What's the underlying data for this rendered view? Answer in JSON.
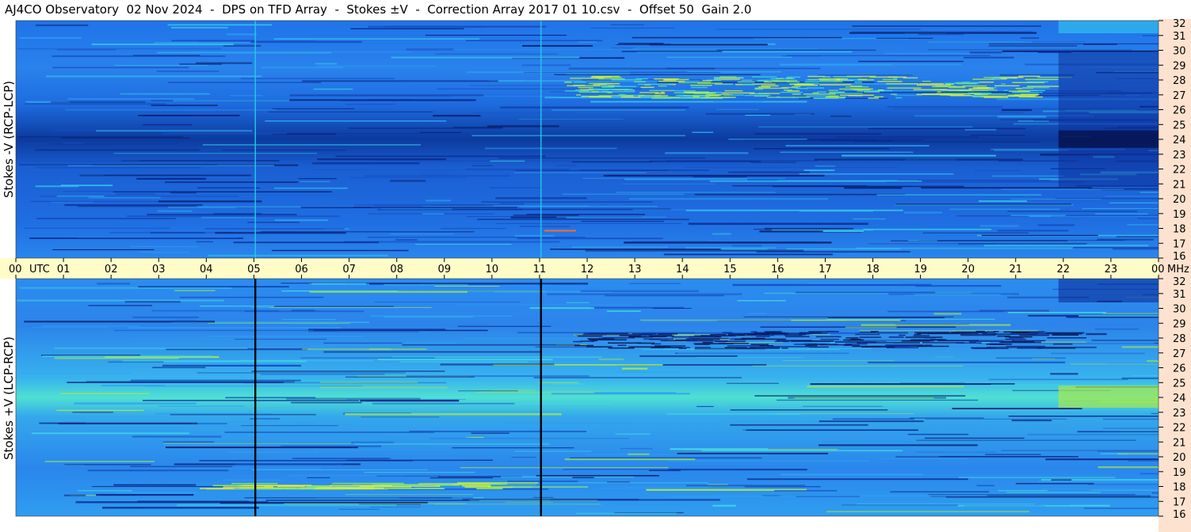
{
  "title": "AJ4CO Observatory  02 Nov 2024  -  DPS on TFD Array  -  Stokes ±V  -  Correction Array 2017 01 10.csv  -  Offset 50  Gain 2.0",
  "colors": {
    "band_bg": "#fffcc8",
    "side_bg": "#fde3cf",
    "background_blue": "#1f6fe6",
    "deep_blue": "#0a2a8f",
    "bright_green": "#b7f23a",
    "cyan": "#25c8e8",
    "hot_orange": "#ff6a2a"
  },
  "chart_data": [
    {
      "type": "heatmap",
      "panel": "top",
      "ylabel": "Stokes -V (RCP-LCP)",
      "xlabel": "UTC",
      "x_ticks": [
        "00",
        "01",
        "02",
        "03",
        "04",
        "05",
        "06",
        "07",
        "08",
        "09",
        "10",
        "11",
        "12",
        "13",
        "14",
        "15",
        "16",
        "17",
        "18",
        "19",
        "20",
        "21",
        "22",
        "23",
        "00"
      ],
      "x_range_hours": [
        0,
        24
      ],
      "y_unit": "MHz",
      "y_ticks": [
        32,
        31,
        30,
        29,
        28,
        27,
        26,
        25,
        24,
        23,
        22,
        21,
        20,
        19,
        18,
        17,
        16
      ],
      "ylim": [
        16,
        32
      ],
      "colormap": "blue-cyan-green-yellow-red",
      "features": {
        "dark_band_mhz": 24,
        "bright_band_mhz": 27.5,
        "vertical_lines_utc": [
          5.03,
          11.03
        ],
        "line_style": "cyan"
      }
    },
    {
      "type": "heatmap",
      "panel": "bottom",
      "ylabel": "Stokes +V (LCP-RCP)",
      "xlabel": "UTC",
      "x_ticks": [
        "00",
        "01",
        "02",
        "03",
        "04",
        "05",
        "06",
        "07",
        "08",
        "09",
        "10",
        "11",
        "12",
        "13",
        "14",
        "15",
        "16",
        "17",
        "18",
        "19",
        "20",
        "21",
        "22",
        "23",
        "00"
      ],
      "x_range_hours": [
        0,
        24
      ],
      "y_unit": "MHz",
      "y_ticks": [
        32,
        31,
        30,
        29,
        28,
        27,
        26,
        25,
        24,
        23,
        22,
        21,
        20,
        19,
        18,
        17,
        16
      ],
      "ylim": [
        16,
        32
      ],
      "colormap": "blue-cyan-green-yellow-red",
      "features": {
        "bright_band_mhz": 24,
        "dark_band_mhz": 27.5,
        "vertical_lines_utc": [
          5.03,
          11.03
        ],
        "line_style": "black"
      }
    }
  ],
  "labels": {
    "utc": "UTC",
    "mhz": "MHz"
  }
}
